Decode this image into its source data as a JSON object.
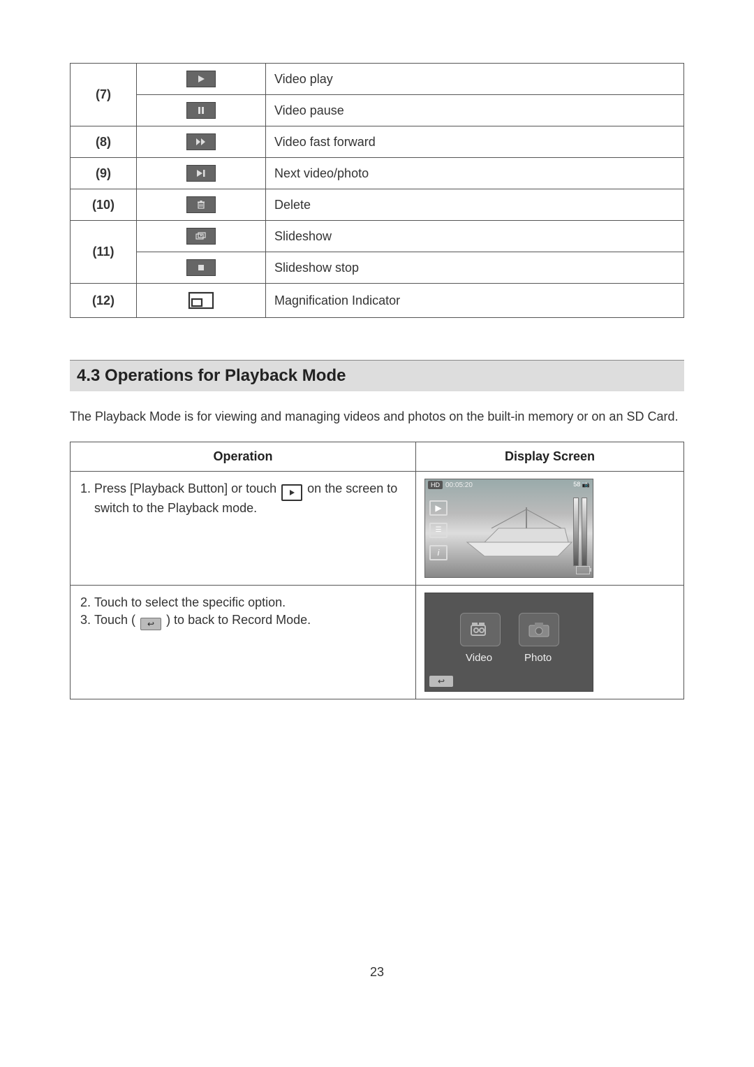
{
  "icon_table": {
    "rows": [
      {
        "num": "(7)",
        "icon": "play",
        "label": "Video play"
      },
      {
        "num": "(7)",
        "icon": "pause",
        "label": "Video pause"
      },
      {
        "num": "(8)",
        "icon": "ffwd",
        "label": "Video fast forward"
      },
      {
        "num": "(9)",
        "icon": "next",
        "label": "Next video/photo"
      },
      {
        "num": "(10)",
        "icon": "trash",
        "label": "Delete"
      },
      {
        "num": "(11)",
        "icon": "slideshow",
        "label": "Slideshow"
      },
      {
        "num": "(11)",
        "icon": "stop",
        "label": "Slideshow stop"
      },
      {
        "num": "(12)",
        "icon": "magnify",
        "label": "Magnification Indicator"
      }
    ]
  },
  "section_heading": "4.3 Operations for Playback Mode",
  "section_intro": "The Playback Mode is for viewing and managing videos and photos on the built-in memory or on an SD Card.",
  "ops_table": {
    "headers": {
      "op": "Operation",
      "ds": "Display Screen"
    },
    "step1_a": "Press [Playback Button] or touch",
    "step1_b": "on the screen to switch to the Playback mode.",
    "step2": "Touch to select the specific option.",
    "step3_a": "Touch (",
    "step3_b": ") to back to Record Mode."
  },
  "screen1": {
    "hd": "HD",
    "time": "00:05:20",
    "count": "58"
  },
  "screen2": {
    "video": "Video",
    "photo": "Photo"
  },
  "page_number": "23"
}
